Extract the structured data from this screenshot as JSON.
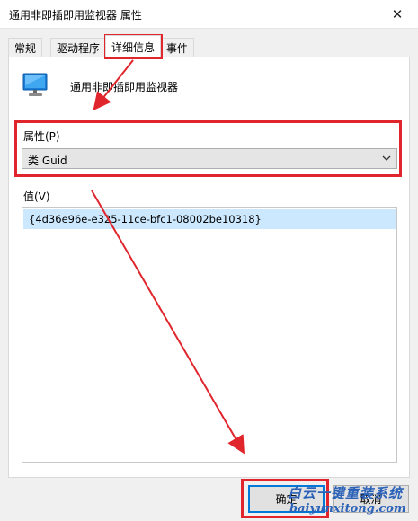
{
  "window": {
    "title": "通用非即插即用监视器 属性",
    "close_glyph": "✕"
  },
  "tabs": [
    {
      "label": "常规"
    },
    {
      "label": "驱动程序"
    },
    {
      "label": "详细信息",
      "active": true
    },
    {
      "label": "事件"
    }
  ],
  "device": {
    "icon": "monitor-icon",
    "name": "通用非即插即用监视器"
  },
  "property": {
    "label": "属性(P)",
    "selected": "类 Guid"
  },
  "value": {
    "label": "值(V)",
    "items": [
      "{4d36e96e-e325-11ce-bfc1-08002be10318}"
    ]
  },
  "buttons": {
    "ok": "确定",
    "cancel": "取消"
  },
  "watermark": {
    "text": "白云一键重装系统",
    "url": "baiyunxitong.com"
  },
  "colors": {
    "highlight": "#e0262c",
    "selection": "#cce8ff",
    "focus": "#0078d7"
  }
}
